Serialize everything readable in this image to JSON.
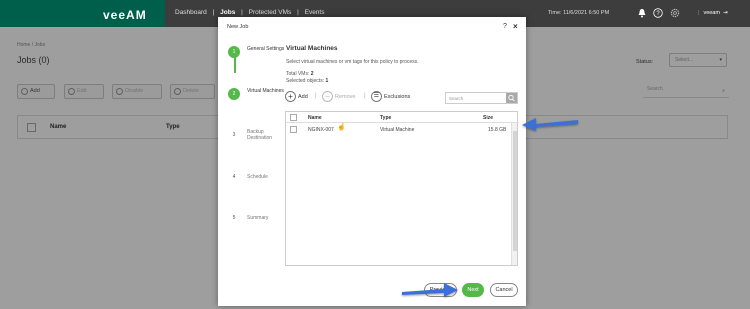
{
  "app": {
    "logo": "veeAM",
    "nav": {
      "dashboard": "Dashboard",
      "sep": "|",
      "jobs": "Jobs",
      "protected_vms": "Protected VMs",
      "events": "Events"
    },
    "time": "Time: 11/6/2021 6:50 PM",
    "user": "veeam"
  },
  "page": {
    "breadcrumb": "Home / Jobs",
    "title": "Jobs (0)",
    "status_label": "Status:",
    "status_placeholder": "Select...",
    "toolbar": {
      "add": "Add",
      "edit": "Edit",
      "disable": "Disable",
      "delete": "Delete"
    },
    "search_placeholder": "Search",
    "table_headers": {
      "name": "Name",
      "type": "Type"
    }
  },
  "dialog": {
    "title": "New Job",
    "help": "?",
    "close": "×",
    "steps": [
      {
        "num": "1",
        "label": "General Settings"
      },
      {
        "num": "2",
        "label": "Virtual Machines"
      },
      {
        "num": "3",
        "label": "Backup Destination"
      },
      {
        "num": "4",
        "label": "Schedule"
      },
      {
        "num": "5",
        "label": "Summary"
      }
    ],
    "content": {
      "title": "Virtual Machines",
      "description": "Select virtual machines or vm tags for this policy to process.",
      "total_label": "Total VMs:",
      "total_value": "2",
      "selected_label": "Selected objects:",
      "selected_value": "1",
      "toolbar": {
        "add": "Add",
        "remove": "Remove",
        "exclusions": "Exclusions"
      },
      "search_placeholder": "Search",
      "table": {
        "headers": {
          "name": "Name",
          "type": "Type",
          "size": "Size"
        },
        "rows": [
          {
            "name": "NGINX-007",
            "type": "Virtual Machine",
            "size": "15.8 GB"
          }
        ]
      }
    },
    "buttons": {
      "previous": "Previous",
      "next": "Next",
      "cancel": "Cancel"
    }
  },
  "colors": {
    "accent_green": "#54b948",
    "brand_green": "#005f4b",
    "arrow_blue": "#3b6fd6"
  }
}
